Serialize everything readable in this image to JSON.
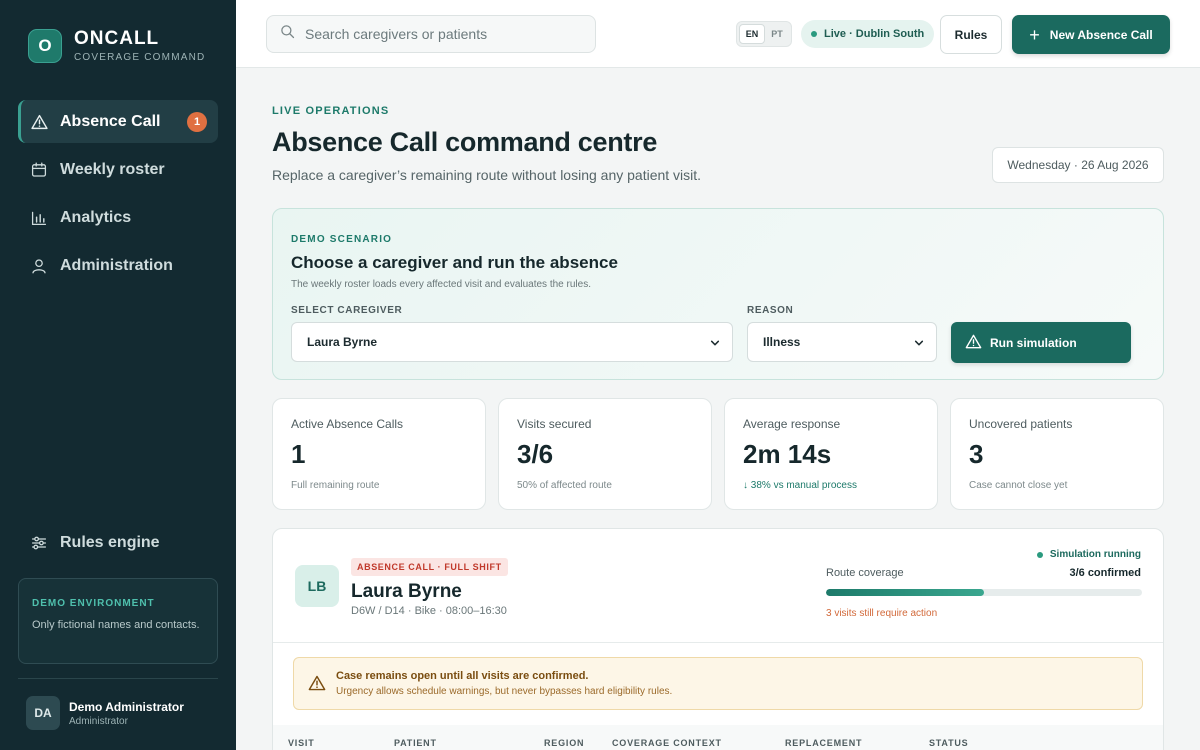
{
  "brand": {
    "logo_letter": "O",
    "name": "ONCALL",
    "subtitle": "COVERAGE COMMAND"
  },
  "nav": {
    "items": [
      {
        "label": "Absence Call",
        "icon": "warning-icon",
        "badge": "1",
        "active": true
      },
      {
        "label": "Weekly roster",
        "icon": "calendar-icon"
      },
      {
        "label": "Analytics",
        "icon": "bar-chart-icon"
      },
      {
        "label": "Administration",
        "icon": "user-icon"
      }
    ],
    "rules_engine": "Rules engine"
  },
  "demo_env": {
    "title": "DEMO ENVIRONMENT",
    "text": "Only fictional names and contacts."
  },
  "user": {
    "initials": "DA",
    "name": "Demo Administrator",
    "role": "Administrator"
  },
  "topbar": {
    "search_placeholder": "Search caregivers or patients",
    "lang": [
      "EN",
      "PT"
    ],
    "live": "Live · Dublin South",
    "rules_button": "Rules",
    "new_button": "New Absence Call"
  },
  "header": {
    "eyebrow": "LIVE OPERATIONS",
    "title": "Absence Call command centre",
    "subtitle": "Replace a caregiver’s remaining route without losing any patient visit.",
    "date": "Wednesday · 26 Aug 2026"
  },
  "scenario": {
    "eyebrow": "DEMO SCENARIO",
    "title": "Choose a caregiver and run the absence",
    "subtitle": "The weekly roster loads every affected visit and evaluates the rules.",
    "caregiver_label": "SELECT CAREGIVER",
    "caregiver_value": "Laura Byrne",
    "reason_label": "REASON",
    "reason_value": "Illness",
    "run_button": "Run simulation"
  },
  "stats": [
    {
      "label": "Active Absence Calls",
      "value": "1",
      "note": "Full remaining route"
    },
    {
      "label": "Visits secured",
      "value": "3/6",
      "note": "50% of affected route"
    },
    {
      "label": "Average response",
      "value": "2m 14s",
      "note": "↓ 38% vs manual process",
      "good": true
    },
    {
      "label": "Uncovered patients",
      "value": "3",
      "note": "Case cannot close yet"
    }
  ],
  "case": {
    "initials": "LB",
    "tag": "ABSENCE CALL · FULL SHIFT",
    "name": "Laura Byrne",
    "meta": "D6W / D14 · Bike · 08:00–16:30",
    "status": "Simulation running",
    "coverage_label": "Route coverage",
    "coverage_value": "3/6 confirmed",
    "coverage_fraction": 0.5,
    "coverage_warning": "3 visits still require action",
    "alert_title": "Case remains open until all visits are confirmed.",
    "alert_text": "Urgency allows schedule warnings, but never bypasses hard eligibility rules.",
    "columns": [
      "VISIT",
      "PATIENT",
      "REGION",
      "COVERAGE CONTEXT",
      "REPLACEMENT",
      "STATUS"
    ]
  },
  "colors": {
    "primary": "#1b6a5f",
    "sidebar": "#132a31",
    "badge": "#e07041",
    "danger": "#c0392b",
    "warning": "#d2693a"
  }
}
